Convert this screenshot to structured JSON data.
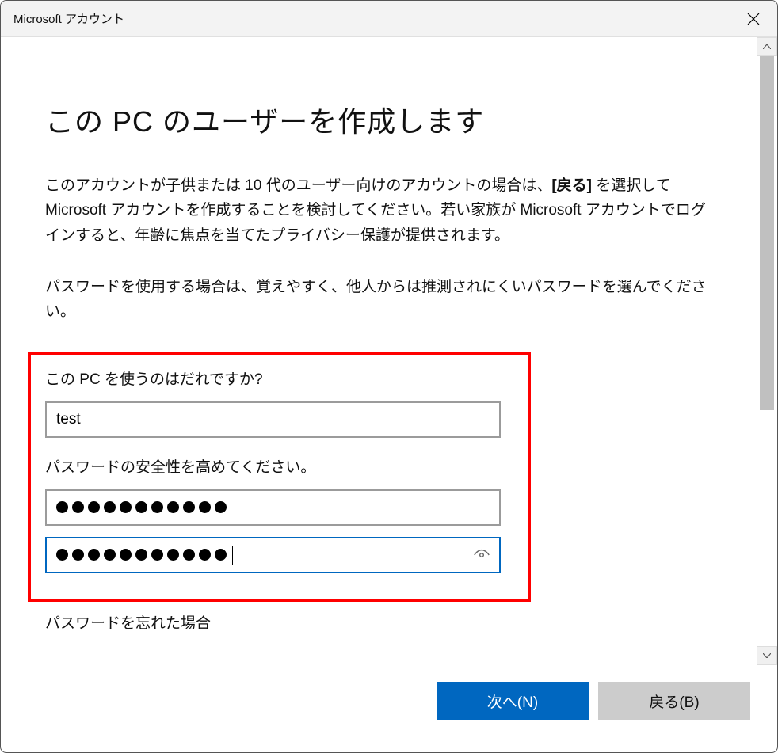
{
  "window": {
    "title": "Microsoft アカウント"
  },
  "page": {
    "heading": "この PC のユーザーを作成します",
    "para1_pre": "このアカウントが子供または 10 代のユーザー向けのアカウントの場合は、",
    "para1_bold": "[戻る]",
    "para1_post": " を選択して Microsoft アカウントを作成することを検討してください。若い家族が Microsoft アカウントでログインすると、年齢に焦点を当てたプライバシー保護が提供されます。",
    "para2": "パスワードを使用する場合は、覚えやすく、他人からは推測されにくいパスワードを選んでください。",
    "who_label": "この PC を使うのはだれですか?",
    "username_value": "test",
    "password_label": "パスワードの安全性を高めてください。",
    "password_value": "●●●●●●●●●●●",
    "password_confirm_value": "●●●●●●●●●●●",
    "password_dot_count": 11,
    "forgot_label": "パスワードを忘れた場合"
  },
  "buttons": {
    "next": "次へ(N)",
    "back": "戻る(B)"
  }
}
